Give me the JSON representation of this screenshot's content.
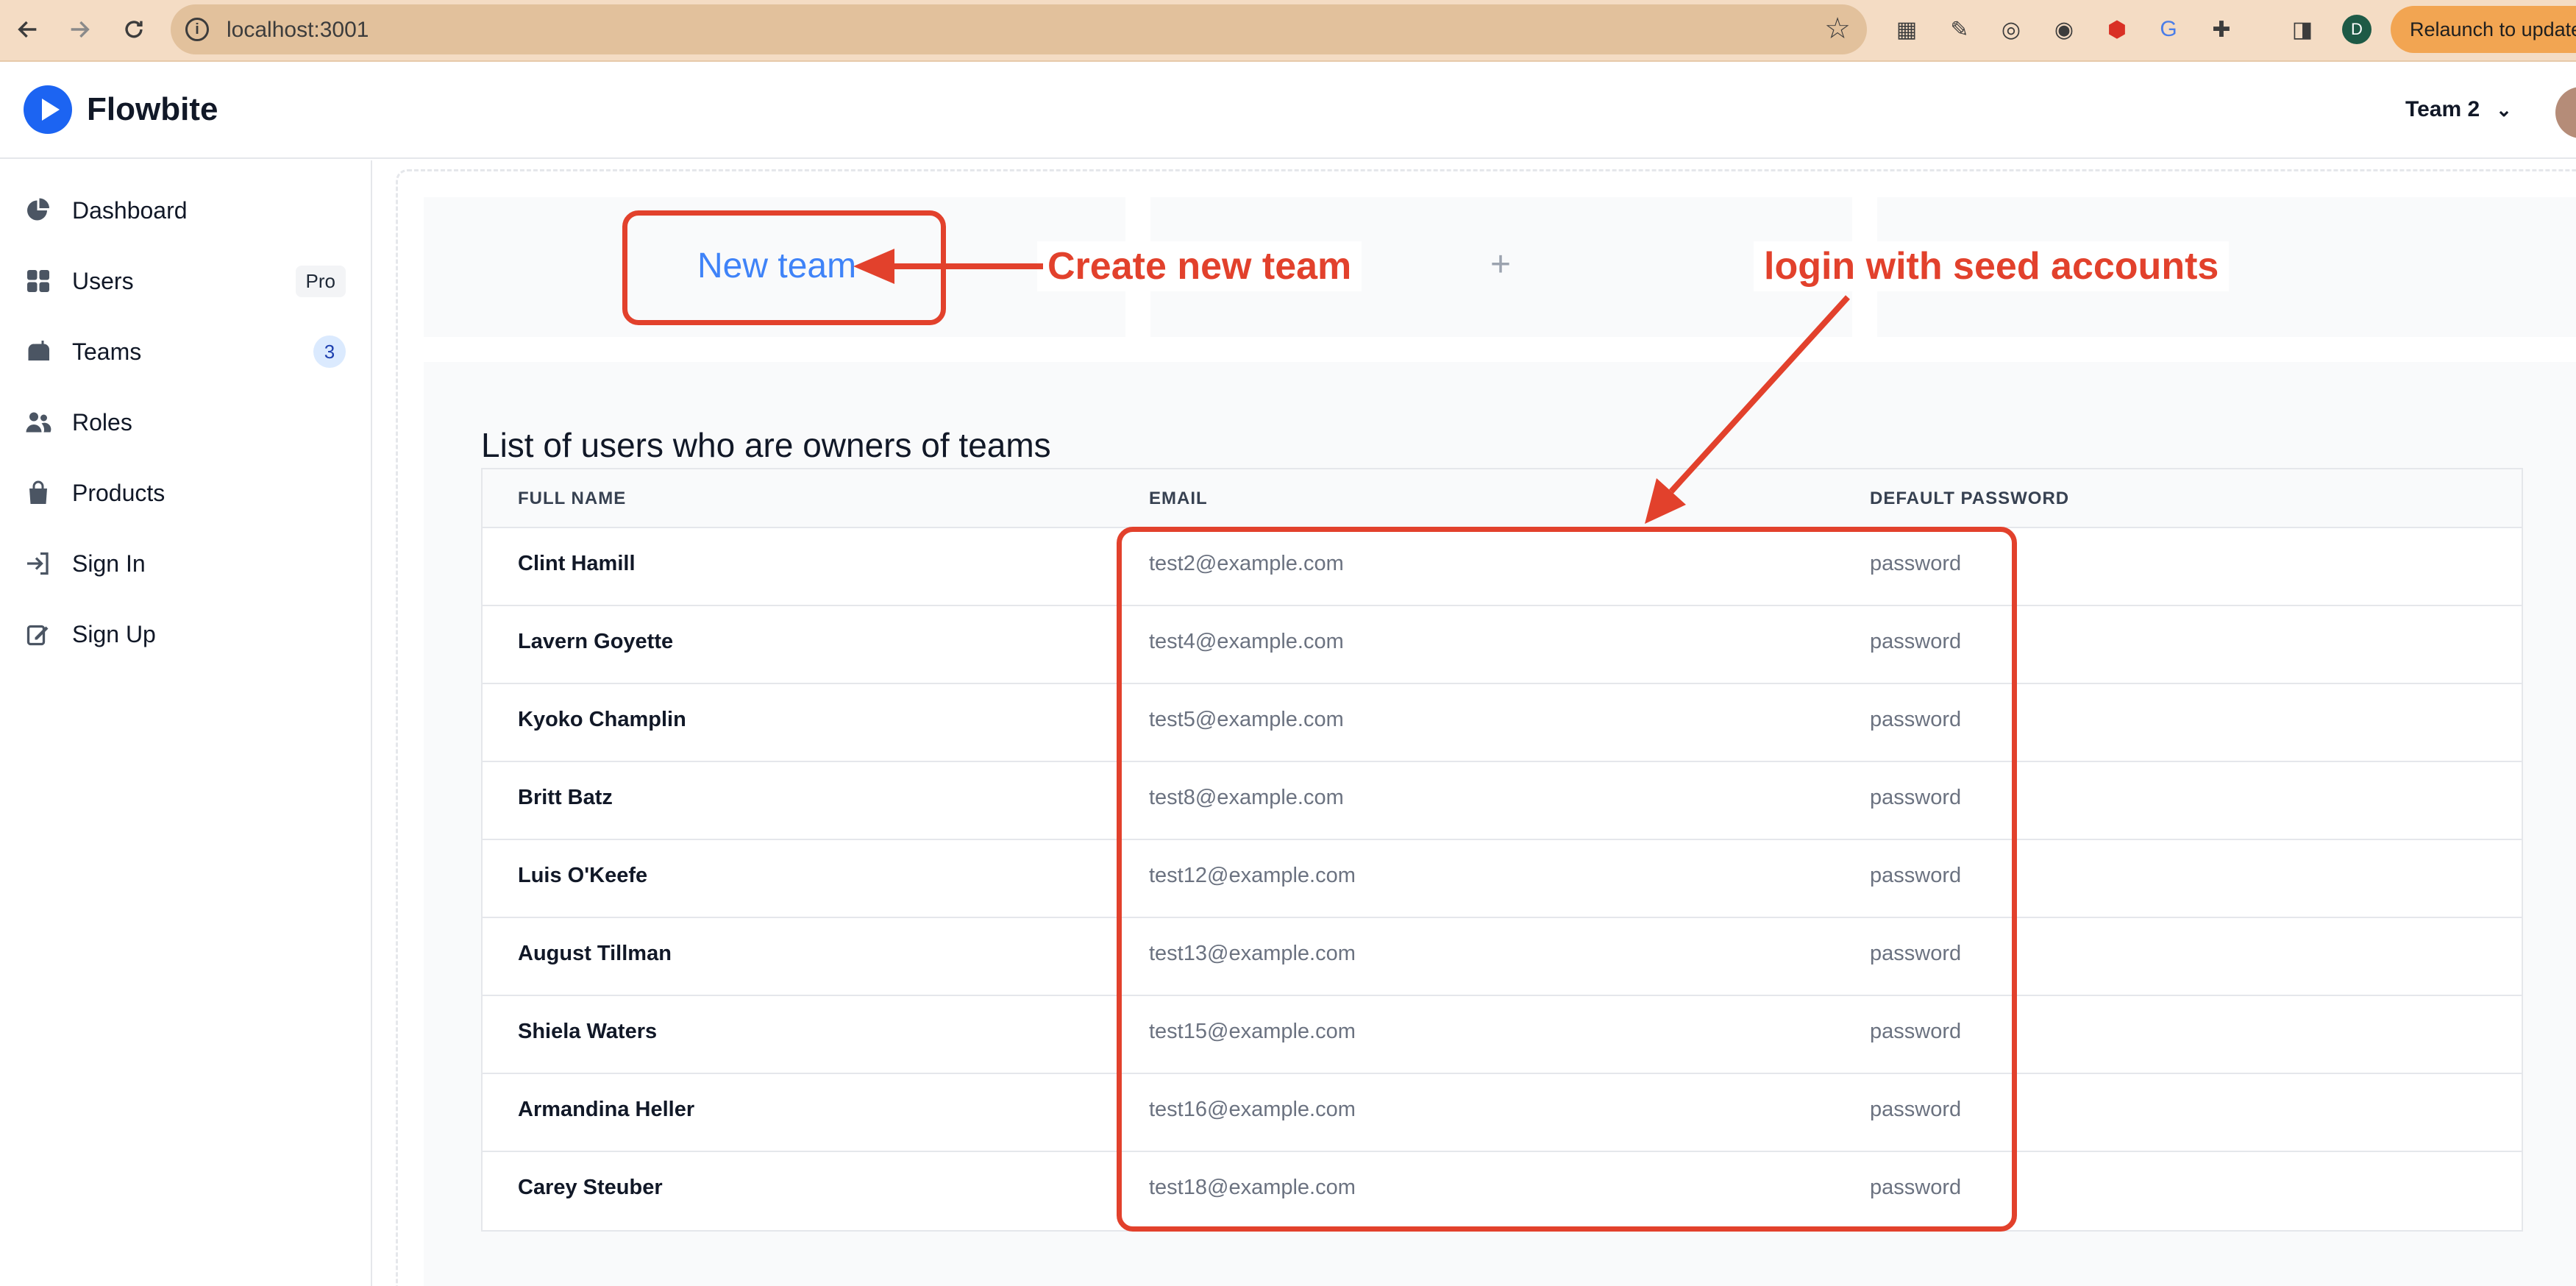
{
  "browser": {
    "url": "localhost:3001",
    "profile_initial": "D",
    "relaunch_label": "Relaunch to update",
    "icons": [
      "back-icon",
      "forward-icon",
      "reload-icon",
      "info-icon",
      "bookmark-star-icon",
      "qr-icon",
      "pen-icon",
      "camera-icon",
      "circle-extension-icon",
      "shield-extension-icon",
      "translate-icon",
      "puzzle-icon",
      "sidepanel-icon"
    ]
  },
  "header": {
    "brand": "Flowbite",
    "team_selector": "Team 2"
  },
  "sidebar": {
    "items": [
      {
        "label": "Dashboard",
        "icon": "pie-chart-icon"
      },
      {
        "label": "Users",
        "icon": "grid-icon",
        "badge": "Pro"
      },
      {
        "label": "Teams",
        "icon": "mailbox-icon",
        "badge": "3"
      },
      {
        "label": "Roles",
        "icon": "users-icon"
      },
      {
        "label": "Products",
        "icon": "shopping-bag-icon"
      },
      {
        "label": "Sign In",
        "icon": "sign-in-icon"
      },
      {
        "label": "Sign Up",
        "icon": "sign-up-icon"
      }
    ]
  },
  "main": {
    "new_team_label": "New team",
    "add_symbol": "+",
    "list_title": "List of users who are owners of teams",
    "table": {
      "headers": [
        "FULL NAME",
        "EMAIL",
        "DEFAULT PASSWORD"
      ],
      "rows": [
        [
          "Clint Hamill",
          "test2@example.com",
          "password"
        ],
        [
          "Lavern Goyette",
          "test4@example.com",
          "password"
        ],
        [
          "Kyoko Champlin",
          "test5@example.com",
          "password"
        ],
        [
          "Britt Batz",
          "test8@example.com",
          "password"
        ],
        [
          "Luis O'Keefe",
          "test12@example.com",
          "password"
        ],
        [
          "August Tillman",
          "test13@example.com",
          "password"
        ],
        [
          "Shiela Waters",
          "test15@example.com",
          "password"
        ],
        [
          "Armandina Heller",
          "test16@example.com",
          "password"
        ],
        [
          "Carey Steuber",
          "test18@example.com",
          "password"
        ]
      ]
    }
  },
  "annotations": {
    "create_label": "Create new team",
    "login_label": "login with seed accounts",
    "color": "#e2412c"
  }
}
